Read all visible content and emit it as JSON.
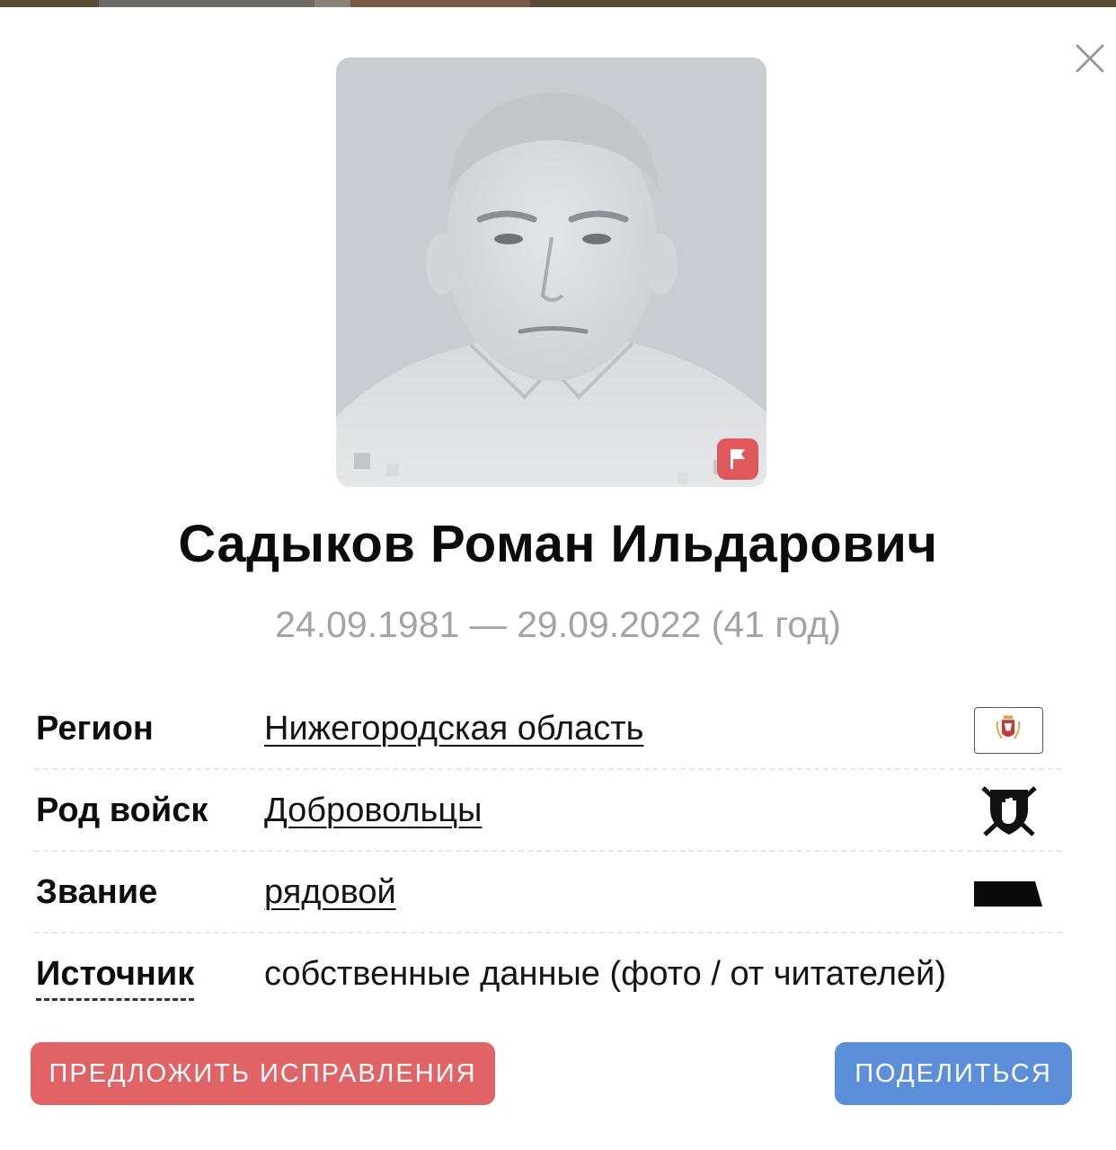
{
  "dialog": {
    "close_icon": "close-icon",
    "photo": {
      "description": "portrait",
      "flag_icon": "flag-icon",
      "flag_color": "#e0585a"
    },
    "name": "Садыков Роман Ильдарович",
    "dates": "24.09.1981 — 29.09.2022 (41 год)"
  },
  "info": {
    "rows": [
      {
        "label": "Регион",
        "value": "Нижегородская область",
        "icon": "region-coat-of-arms-icon"
      },
      {
        "label": "Род войск",
        "value": "Добровольцы",
        "icon": "volunteers-emblem-icon"
      },
      {
        "label": "Звание",
        "value": "рядовой",
        "icon": "rank-insignia-icon"
      },
      {
        "label": "Источник",
        "value": "собственные данные (фото / от читателей)"
      }
    ]
  },
  "actions": {
    "suggest_label": "ПРЕДЛОЖИТЬ ИСПРАВЛЕНИЯ",
    "share_label": "ПОДЕЛИТЬСЯ"
  },
  "colors": {
    "suggest_button": "#e06366",
    "share_button": "#5b8fd9",
    "dates_text": "#a3a3a3"
  }
}
